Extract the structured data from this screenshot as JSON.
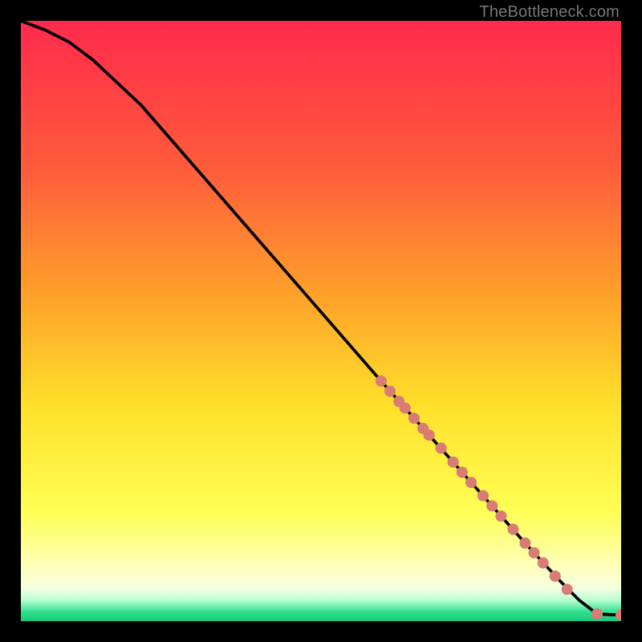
{
  "watermark": "TheBottleneck.com",
  "colors": {
    "bg": "#000000",
    "line": "#000000",
    "dot": "#d87c75",
    "watermark": "#777777",
    "gradient_stops": [
      {
        "offset": 0.0,
        "color": "#ff2a4c"
      },
      {
        "offset": 0.24,
        "color": "#ff5a3c"
      },
      {
        "offset": 0.46,
        "color": "#ffa22a"
      },
      {
        "offset": 0.64,
        "color": "#ffe02a"
      },
      {
        "offset": 0.82,
        "color": "#ffff55"
      },
      {
        "offset": 0.9,
        "color": "#ffffb0"
      },
      {
        "offset": 0.945,
        "color": "#f6ffe0"
      },
      {
        "offset": 0.965,
        "color": "#b8ffd0"
      },
      {
        "offset": 0.985,
        "color": "#30e090"
      },
      {
        "offset": 1.0,
        "color": "#16c877"
      }
    ]
  },
  "chart_data": {
    "type": "line",
    "title": "",
    "xlabel": "",
    "ylabel": "",
    "xlim": [
      0,
      100
    ],
    "ylim": [
      0,
      100
    ],
    "series": [
      {
        "name": "curve",
        "x": [
          0,
          4,
          8,
          12,
          20,
          30,
          40,
          50,
          60,
          68,
          76,
          84,
          90,
          93,
          96,
          100
        ],
        "y": [
          100,
          98.5,
          96.5,
          93.5,
          86,
          74.5,
          63,
          51.5,
          40,
          31,
          22,
          13,
          6.5,
          3.5,
          1.2,
          1
        ]
      }
    ],
    "dots": {
      "name": "points-on-curve",
      "x": [
        60,
        61.5,
        63,
        64,
        65.5,
        67,
        68,
        70,
        72,
        73.5,
        75,
        77,
        78.5,
        80,
        82,
        84,
        85.5,
        87,
        89,
        91,
        96,
        100
      ],
      "y": [
        40,
        38.3,
        36.6,
        35.5,
        33.8,
        32.1,
        31,
        28.8,
        26.5,
        24.8,
        23.1,
        20.9,
        19.2,
        17.5,
        15.3,
        13,
        11.4,
        9.7,
        7.5,
        5.3,
        1.2,
        1
      ],
      "r": 7
    },
    "extra_segment": {
      "from": [
        96,
        1.2
      ],
      "to": [
        100,
        1
      ]
    }
  }
}
